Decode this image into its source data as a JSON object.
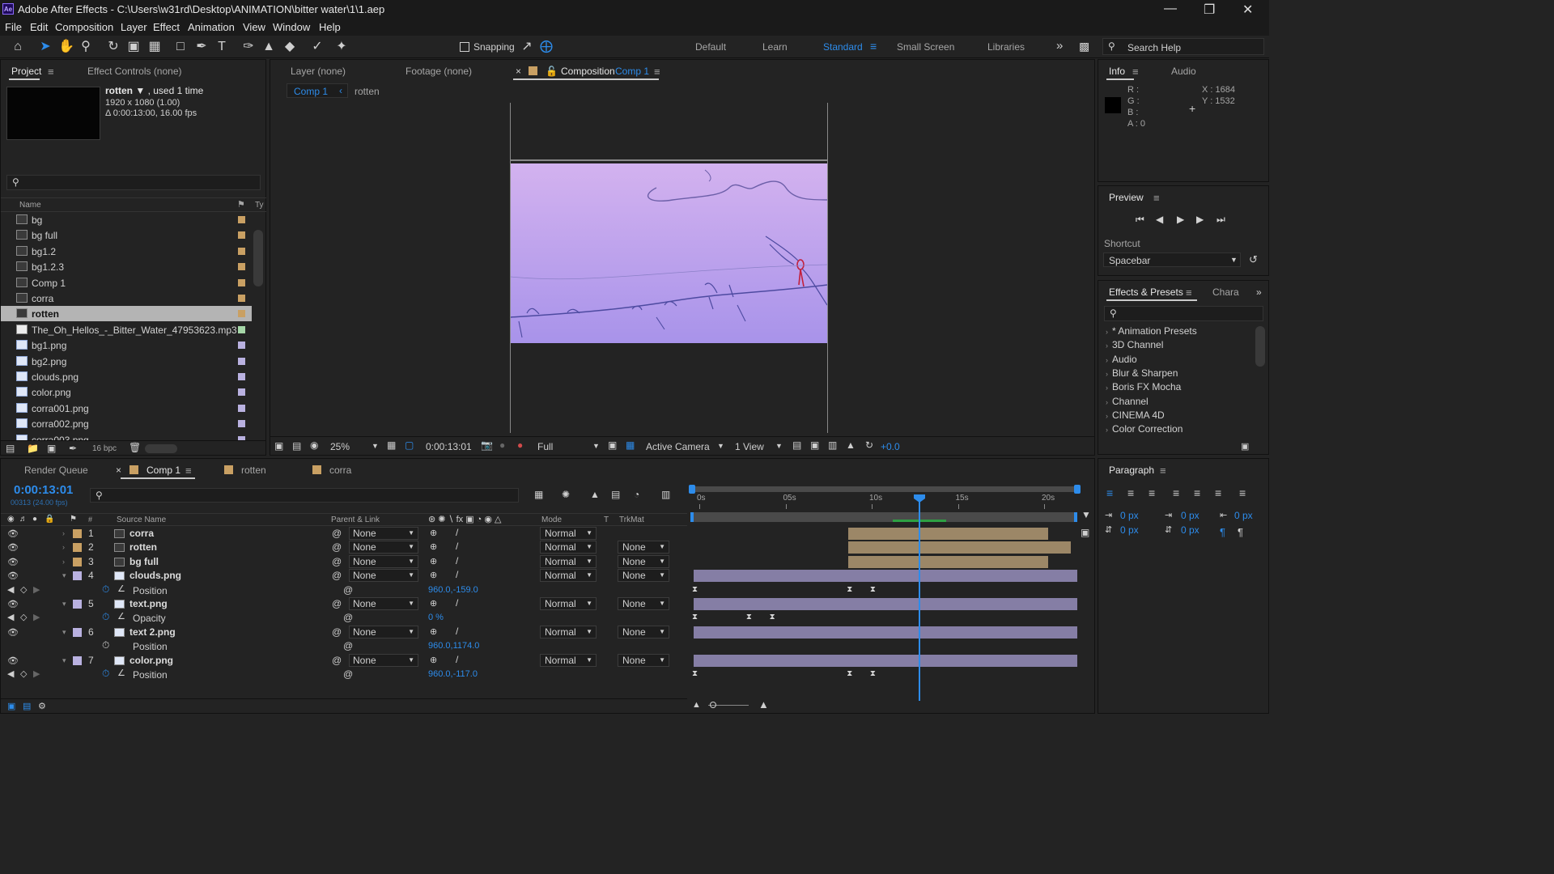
{
  "window": {
    "app_badge": "Ae",
    "title": "Adobe After Effects - C:\\Users\\w31rd\\Desktop\\ANIMATION\\bitter water\\1\\1.aep"
  },
  "menu": [
    "File",
    "Edit",
    "Composition",
    "Layer",
    "Effect",
    "Animation",
    "View",
    "Window",
    "Help"
  ],
  "toolbar": {
    "snapping_label": "Snapping",
    "workspaces": [
      "Default",
      "Learn",
      "Standard",
      "Small Screen",
      "Libraries"
    ],
    "active_workspace": "Standard",
    "search_placeholder": "Search Help"
  },
  "project_panel": {
    "tab_project": "Project",
    "tab_effect_controls": "Effect Controls (none)",
    "selected_name": "rotten",
    "used": ", used 1 time",
    "dimensions": "1920 x 1080 (1.00)",
    "duration": "Δ 0:00:13:00, 16.00 fps",
    "col_name": "Name",
    "col_type": "Ty",
    "bpc": "16 bpc",
    "items": [
      {
        "name": "bg",
        "kind": "comp",
        "label": "#c9a063"
      },
      {
        "name": "bg full",
        "kind": "comp",
        "label": "#c9a063"
      },
      {
        "name": "bg1.2",
        "kind": "comp",
        "label": "#c9a063"
      },
      {
        "name": "bg1.2.3",
        "kind": "comp",
        "label": "#c9a063"
      },
      {
        "name": "Comp 1",
        "kind": "comp",
        "label": "#c9a063"
      },
      {
        "name": "corra",
        "kind": "comp",
        "label": "#c9a063"
      },
      {
        "name": "rotten",
        "kind": "comp",
        "label": "#c9a063",
        "selected": true
      },
      {
        "name": "The_Oh_Hellos_-_Bitter_Water_47953623.mp3",
        "kind": "audio",
        "label": "#a5d6a7"
      },
      {
        "name": "bg1.png",
        "kind": "file",
        "label": "#b9b1e0"
      },
      {
        "name": "bg2.png",
        "kind": "file",
        "label": "#b9b1e0"
      },
      {
        "name": "clouds.png",
        "kind": "file",
        "label": "#b9b1e0"
      },
      {
        "name": "color.png",
        "kind": "file",
        "label": "#b9b1e0"
      },
      {
        "name": "corra001.png",
        "kind": "file",
        "label": "#b9b1e0"
      },
      {
        "name": "corra002.png",
        "kind": "file",
        "label": "#b9b1e0"
      },
      {
        "name": "corra003.png",
        "kind": "file",
        "label": "#b9b1e0"
      }
    ]
  },
  "viewer": {
    "tab_layer": "Layer  (none)",
    "tab_footage": "Footage  (none)",
    "tab_comp_prefix": "Composition",
    "tab_comp_name": "Comp 1",
    "crumb_comp": "Comp 1",
    "crumb_rotten": "rotten",
    "zoom": "25%",
    "timecode": "0:00:13:01",
    "resolution": "Full",
    "camera": "Active Camera",
    "views": "1 View",
    "exposure": "+0.0"
  },
  "info_panel": {
    "tab_info": "Info",
    "tab_audio": "Audio",
    "r": "R :",
    "g": "G :",
    "b": "B :",
    "a": "A :  0",
    "x": "X : 1684",
    "y": "Y : 1532"
  },
  "preview_panel": {
    "title": "Preview",
    "shortcut_label": "Shortcut",
    "shortcut_value": "Spacebar"
  },
  "effects_panel": {
    "tab": "Effects & Presets",
    "tab2": "Chara",
    "items": [
      "* Animation Presets",
      "3D Channel",
      "Audio",
      "Blur & Sharpen",
      "Boris FX Mocha",
      "Channel",
      "CINEMA 4D",
      "Color Correction"
    ]
  },
  "paragraph_panel": {
    "title": "Paragraph",
    "indent_left": "0 px",
    "indent_right": "0 px",
    "indent_first": "0 px",
    "space_before": "0 px",
    "space_after": "0 px"
  },
  "timeline": {
    "tab_render": "Render Queue",
    "tab_comp1": "Comp 1",
    "tab_rotten": "rotten",
    "tab_corra": "corra",
    "timecode": "0:00:13:01",
    "frame_info": "00313 (24.00 fps)",
    "col_hash": "#",
    "col_source": "Source Name",
    "col_parent": "Parent & Link",
    "col_mode": "Mode",
    "col_t": "T",
    "col_trkmat": "TrkMat",
    "ruler": [
      "0s",
      "05s",
      "10s",
      "15s",
      "20s"
    ],
    "current_time_fraction": 0.59,
    "layers": [
      {
        "num": "1",
        "name": "corra",
        "parent": "None",
        "mode": "Normal",
        "trkmat": "",
        "label": "#c9a063",
        "bar": {
          "start": 0.4,
          "end": 0.92,
          "color": "#9c8767"
        }
      },
      {
        "num": "2",
        "name": "rotten",
        "parent": "None",
        "mode": "Normal",
        "trkmat": "None",
        "label": "#c9a063",
        "bar": {
          "start": 0.4,
          "end": 0.98,
          "color": "#9c8767"
        }
      },
      {
        "num": "3",
        "name": "bg full",
        "parent": "None",
        "mode": "Normal",
        "trkmat": "None",
        "label": "#c9a063",
        "bar": {
          "start": 0.4,
          "end": 0.92,
          "color": "#9c8767"
        }
      },
      {
        "num": "4",
        "name": "clouds.png",
        "parent": "None",
        "mode": "Normal",
        "trkmat": "None",
        "label": "#b9b1e0",
        "bar": {
          "start": 0.0,
          "end": 1.0,
          "color": "#857ea5"
        },
        "prop": {
          "name": "Position",
          "value": "960.0,-159.0",
          "kf": [
            0.0,
            0.4,
            0.46
          ]
        }
      },
      {
        "num": "5",
        "name": "text.png",
        "parent": "None",
        "mode": "Normal",
        "trkmat": "None",
        "label": "#b9b1e0",
        "bar": {
          "start": 0.0,
          "end": 1.0,
          "color": "#857ea5"
        },
        "prop": {
          "name": "Opacity",
          "value": "0 %",
          "kf": [
            0.0,
            0.14,
            0.2
          ]
        }
      },
      {
        "num": "6",
        "name": "text 2.png",
        "parent": "None",
        "mode": "Normal",
        "trkmat": "None",
        "label": "#b9b1e0",
        "bar": {
          "start": 0.0,
          "end": 1.0,
          "color": "#857ea5"
        },
        "prop": {
          "name": "Position",
          "value": "960.0,1174.0",
          "kf": []
        }
      },
      {
        "num": "7",
        "name": "color.png",
        "parent": "None",
        "mode": "Normal",
        "trkmat": "None",
        "label": "#b9b1e0",
        "bar": {
          "start": 0.0,
          "end": 1.0,
          "color": "#857ea5"
        },
        "prop": {
          "name": "Position",
          "value": "960.0,-117.0",
          "kf": [
            0.0,
            0.4,
            0.46
          ]
        }
      }
    ]
  }
}
